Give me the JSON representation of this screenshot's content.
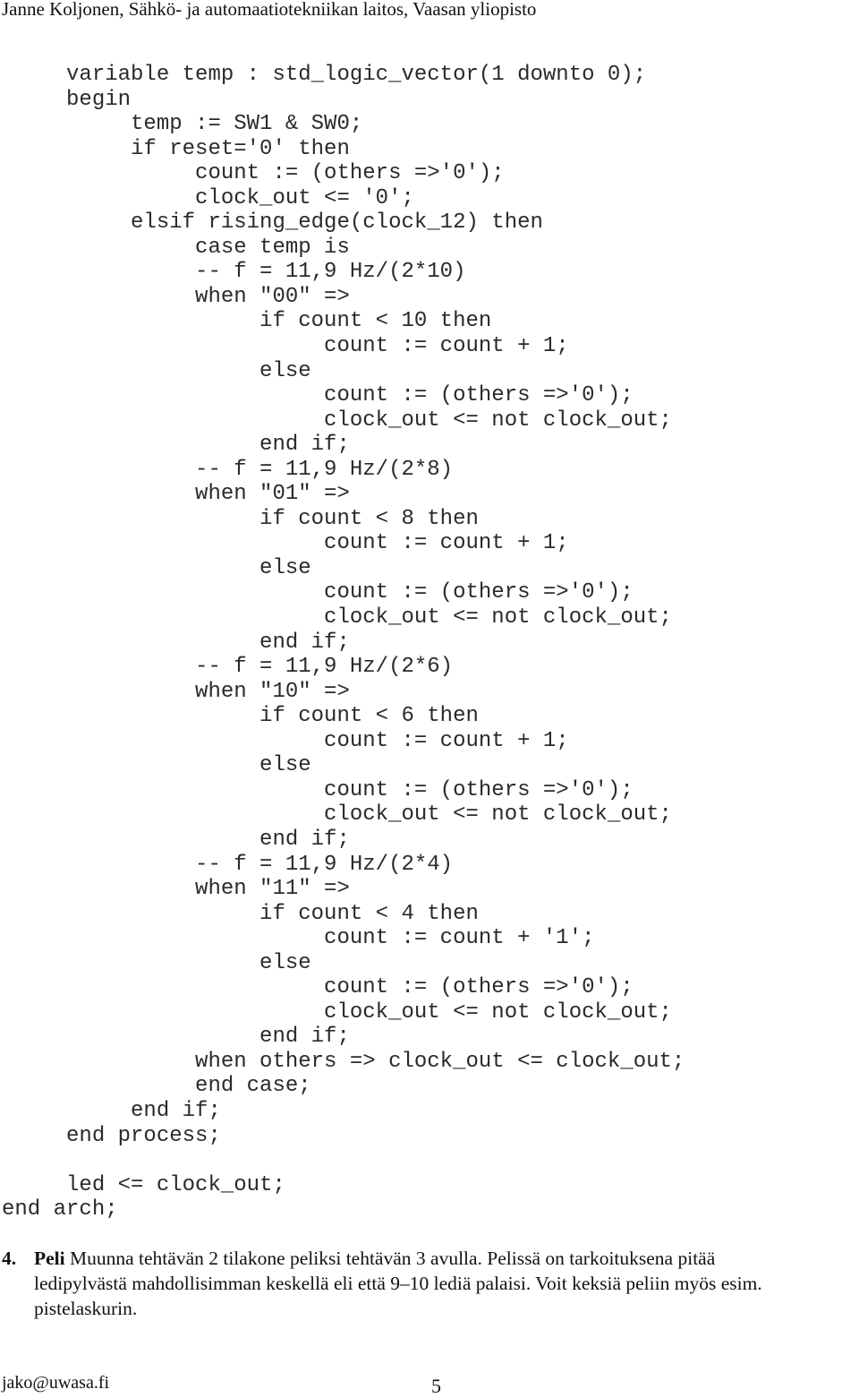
{
  "header": {
    "text": "Janne Koljonen, Sähkö- ja automaatiotekniikan laitos, Vaasan yliopisto"
  },
  "code": {
    "language": "VHDL",
    "lines": [
      "     variable temp : std_logic_vector(1 downto 0);",
      "     begin",
      "          temp := SW1 & SW0;",
      "          if reset='0' then",
      "               count := (others =>'0');",
      "               clock_out <= '0';",
      "          elsif rising_edge(clock_12) then",
      "               case temp is",
      "               -- f = 11,9 Hz/(2*10)",
      "               when \"00\" =>",
      "                    if count < 10 then",
      "                         count := count + 1;",
      "                    else",
      "                         count := (others =>'0');",
      "                         clock_out <= not clock_out;",
      "                    end if;",
      "               -- f = 11,9 Hz/(2*8)",
      "               when \"01\" =>",
      "                    if count < 8 then",
      "                         count := count + 1;",
      "                    else",
      "                         count := (others =>'0');",
      "                         clock_out <= not clock_out;",
      "                    end if;",
      "               -- f = 11,9 Hz/(2*6)",
      "               when \"10\" =>",
      "                    if count < 6 then",
      "                         count := count + 1;",
      "                    else",
      "                         count := (others =>'0');",
      "                         clock_out <= not clock_out;",
      "                    end if;",
      "               -- f = 11,9 Hz/(2*4)",
      "               when \"11\" =>",
      "                    if count < 4 then",
      "                         count := count + '1';",
      "                    else",
      "                         count := (others =>'0');",
      "                         clock_out <= not clock_out;",
      "                    end if;",
      "               when others => clock_out <= clock_out;",
      "               end case;",
      "          end if;",
      "     end process;",
      "",
      "     led <= clock_out;",
      "end arch;"
    ]
  },
  "task": {
    "number": "4.",
    "title": "Peli",
    "line1": " Muunna tehtävän 2 tilakone peliksi tehtävän 3 avulla. Pelissä on tarkoituksena pitää",
    "line2": "ledipylvästä mahdollisimman keskellä eli että 9–10 lediä palaisi. Voit keksiä peliin myös esim.",
    "line3": "pistelaskurin."
  },
  "footer": {
    "email": "jako@uwasa.fi",
    "page_number": "5"
  }
}
